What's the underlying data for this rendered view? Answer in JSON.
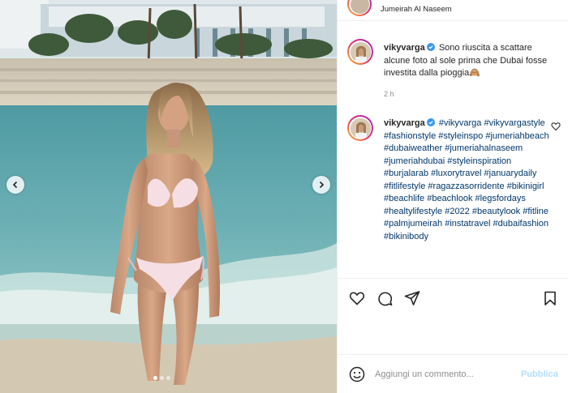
{
  "colors": {
    "link": "#00376b",
    "verified": "#3897f0",
    "publish_disabled": "#b2dffc",
    "muted": "#8e8e8e"
  },
  "media": {
    "carousel": {
      "count": 3,
      "active_index": 0
    },
    "icons": {
      "prev": "chevron-left-icon",
      "next": "chevron-right-icon"
    }
  },
  "location": {
    "text": "Jumeirah Al Naseem"
  },
  "post": {
    "username": "vikyvarga",
    "caption": "Sono riuscita a scattare alcune foto al sole prima che Dubai fosse investita dalla pioggia🙈",
    "time": "2 h"
  },
  "comment": {
    "username": "vikyvarga",
    "hashtags": "#vikyvarga #vikyvargastyle #fashionstyle #styleinspo #jumeriahbeach #dubaiweather #jumeriahalnaseem #jumeriahdubai #styleinspiration #burjalarab #luxorytravel #januarydaily #fitlifestyle #ragazzasorridente #bikinigirl #beachlife #beachlook #legsfordays #healtylifestyle #2022 #beautylook #fitline #palmjumeirah #instatravel #dubaifashion #bikinibody"
  },
  "actions": {
    "icons": [
      "heart-icon",
      "comment-icon",
      "share-icon",
      "bookmark-icon"
    ]
  },
  "comment_box": {
    "placeholder": "Aggiungi un commento...",
    "publish_label": "Pubblica"
  }
}
